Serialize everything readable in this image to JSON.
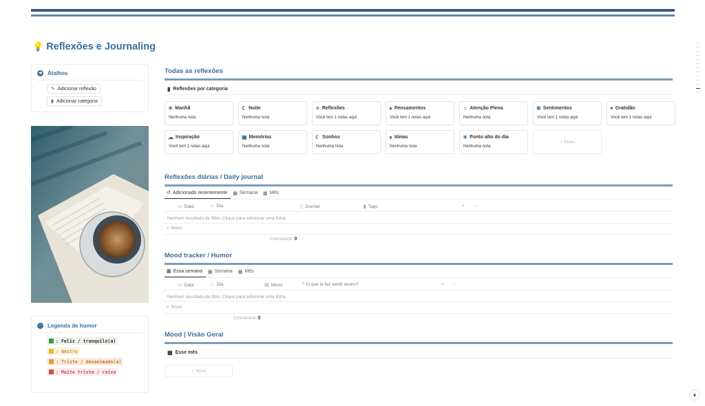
{
  "page": {
    "icon": "lightbulb-icon",
    "title": "Reflexões e Journaling"
  },
  "shortcuts": {
    "title": "Atalhos",
    "icon": "arrow-circle-icon",
    "add_reflection": "Adicionar reflexão",
    "add_category": "Adicionar categoria"
  },
  "legend": {
    "title": "Legenda de humor",
    "items": [
      {
        "label": ": Feliz / tranquilo(a)",
        "color": "#2ea043",
        "text": "#37352f",
        "bg": "#eef3ed"
      },
      {
        "label": ": Neutro",
        "color": "#f0b72f",
        "text": "#c29343",
        "bg": "#fbf3db"
      },
      {
        "label": ": Triste / desanimado(a)",
        "color": "#e59a3c",
        "text": "#c47a35",
        "bg": "#fbecdd"
      },
      {
        "label": ": Muito triste / raiva",
        "color": "#d44c47",
        "text": "#c4554d",
        "bg": "#fdebec"
      }
    ]
  },
  "all_reflections": {
    "title": "Todas as reflexões",
    "view_label": "Reflexões por categoria",
    "categories": [
      {
        "name": "Manhã",
        "icon": "sun-icon",
        "glyph": "☀",
        "desc": "Nenhuma nota"
      },
      {
        "name": "Noite",
        "icon": "moon-icon",
        "glyph": "☾",
        "desc": "Nenhuma nota"
      },
      {
        "name": "Reflexões",
        "icon": "sparkles-icon",
        "glyph": "✧",
        "desc": "Você tem 1 notas aqui"
      },
      {
        "name": "Pensamentos",
        "icon": "bulb-icon",
        "glyph": "●",
        "desc": "Você tem 1 notas aqui"
      },
      {
        "name": "Atenção Plena",
        "icon": "sun-outline-icon",
        "glyph": "☼",
        "desc": "Nenhuma nota"
      },
      {
        "name": "Sentimentos",
        "icon": "flower-icon",
        "glyph": "✻",
        "desc": "Você tem 1 notas aqui"
      },
      {
        "name": "Gratidão",
        "icon": "heart-icon",
        "glyph": "♥",
        "desc": "Você tem 1 notas aqui"
      },
      {
        "name": "Inspiração",
        "icon": "cloud-icon",
        "glyph": "☁",
        "desc": "Você tem 1 notas aqui"
      },
      {
        "name": "Memórias",
        "icon": "chest-icon",
        "glyph": "▣",
        "desc": "Nenhuma nota"
      },
      {
        "name": "Sonhos",
        "icon": "moon-icon",
        "glyph": "☾",
        "desc": "Nenhuma nota"
      },
      {
        "name": "Ideias",
        "icon": "bulb-icon",
        "glyph": "●",
        "desc": "Nenhuma nota"
      },
      {
        "name": "Ponto alto do dia",
        "icon": "sun-icon",
        "glyph": "☀",
        "desc": "Nenhuma nota"
      }
    ],
    "new_label": "+ Novo"
  },
  "daily": {
    "title": "Reflexões diárias / Daily journal",
    "tabs": [
      "Adicionado recentemente",
      "Semana",
      "Mês"
    ],
    "columns": [
      "Data",
      "Dia",
      "Journal",
      "Tags"
    ],
    "empty": "Nenhum resultado de filtro. Clique para adicionar uma linha.",
    "new_label": "Novo",
    "count_label": "CONTAGEM",
    "count_value": "0"
  },
  "mood": {
    "title": "Mood tracker / Humor",
    "tabs": [
      "Essa semana",
      "Semana",
      "Mês"
    ],
    "columns": [
      "Data",
      "Dia",
      "Mood",
      "O que te fez sentir assim?"
    ],
    "empty": "Nenhum resultado de filtro. Clique para adicionar uma linha.",
    "new_label": "Novo",
    "count_label": "CONTAGEM",
    "count_value": "0"
  },
  "overview": {
    "title": "Mood | Visão Geral",
    "view_label": "Esse mês",
    "new_label": "Novo"
  }
}
